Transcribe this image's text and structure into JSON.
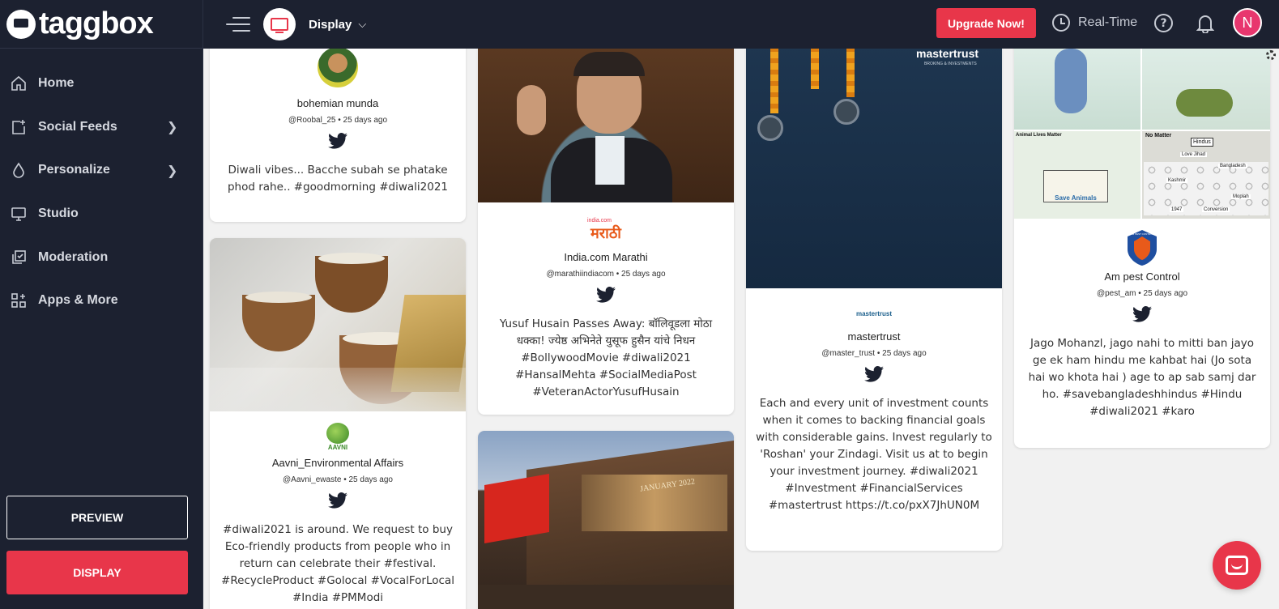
{
  "brand": {
    "name": "taggbox"
  },
  "sidebar": {
    "items": [
      {
        "label": "Home",
        "icon": "home-icon"
      },
      {
        "label": "Social Feeds",
        "icon": "add-feed-icon",
        "has_submenu": true
      },
      {
        "label": "Personalize",
        "icon": "droplet-icon",
        "has_submenu": true
      },
      {
        "label": "Studio",
        "icon": "monitor-icon"
      },
      {
        "label": "Moderation",
        "icon": "moderation-icon"
      },
      {
        "label": "Apps & More",
        "icon": "apps-icon"
      }
    ],
    "preview_label": "PREVIEW",
    "display_label": "DISPLAY"
  },
  "topbar": {
    "display_label": "Display",
    "upgrade_label": "Upgrade Now!",
    "realtime_label": "Real-Time",
    "help_label": "?",
    "avatar_initial": "N"
  },
  "feed": {
    "posts": [
      {
        "author": "bohemian munda",
        "handle": "@Roobal_25",
        "time": "25 days ago",
        "text": "Diwali vibes... Bacche subah se phatake phod rahe.. #goodmorning #diwali2021"
      },
      {
        "author": "Aavni_Environmental Affairs",
        "handle": "@Aavni_ewaste",
        "time": "25 days ago",
        "brand_text": "AAVNI",
        "text": "#diwali2021 is around. We request to buy Eco-friendly products from people who in return can celebrate their #festival. #RecycleProduct #Golocal #VocalForLocal #India #PMModi"
      },
      {
        "author": "India.com Marathi",
        "handle": "@marathiindiacom",
        "time": "25 days ago",
        "brand_text": "मराठी",
        "brand_small": "india.com",
        "text": "Yusuf Husain Passes Away: बॉलिवूडला मोठा धक्का! ज्येष्ठ अभिनेते युसूफ हुसैन यांचे निधन #BollywoodMovie #diwali2021 #HansalMehta #SocialMediaPost #VeteranActorYusufHusain"
      },
      {
        "author": "mastertrust",
        "handle": "@master_trust",
        "time": "25 days ago",
        "brand_text": "mastertrust",
        "image_text": "mastertrust",
        "image_subtext": "BROKING & INVESTMENTS",
        "text": "Each and every unit of investment counts when it comes to backing financial goals with considerable gains. Invest regularly to 'Roshan' your Zindagi. Visit us at to begin your investment journey. #diwali2021 #Investment #FinancialServices #mastertrust https://t.co/pxX7JhUN0M"
      },
      {
        "author": "Am pest Control",
        "handle": "@pest_am",
        "time": "25 days ago",
        "brand_text": "AM PEST CONTROL",
        "text": "Jago Mohanzl, jago nahi to mitti ban jayo ge ek ham hindu me kahbat hai (Jo sota hai wo khota hai ) age to ap sab samj dar ho. #savebangladeshhindus #Hindu #diwali2021 #karo",
        "comic_labels": [
          "Animal Lives Matter",
          "No Matter",
          "Save Animals",
          "Hindus",
          "Love Jihad",
          "Bangladesh",
          "Kashmir",
          "Moplah",
          "1947",
          "Conversion"
        ]
      }
    ],
    "cinema_text": "JANUARY 2022"
  },
  "colors": {
    "accent": "#e8364a",
    "sidebar_bg": "#1c2130",
    "twitter": "#1c2130"
  }
}
